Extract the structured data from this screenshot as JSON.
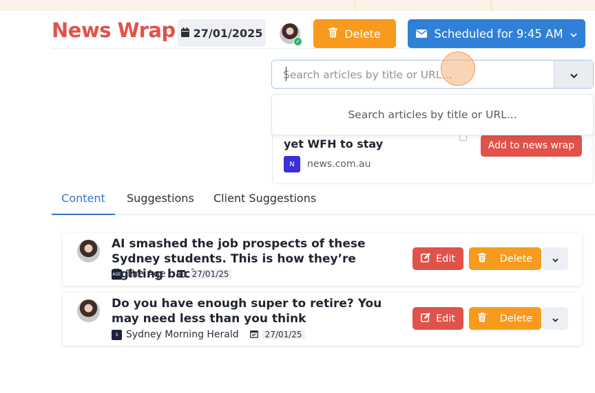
{
  "header": {
    "title": "News Wrap",
    "date": "27/01/2025",
    "delete_label": "Delete",
    "scheduled_label": "Scheduled for 9:45 AM"
  },
  "search": {
    "placeholder": "Search articles by title or URL...",
    "dropdown_text": "Search articles by title or URL..."
  },
  "suggestion_panel": {
    "title": "yet WFH to stay",
    "add_label": "Add to news wrap",
    "source_badge": "N",
    "source": "news.com.au"
  },
  "tabs": [
    "Content",
    "Suggestions",
    "Client Suggestions"
  ],
  "articles": [
    {
      "title": "AI smashed the job prospects of these Sydney students. This is how they’re fighting back",
      "source_badge": "AGE",
      "source": "The Age",
      "date": "27/01/25",
      "edit_label": "Edit",
      "delete_label": "Delete"
    },
    {
      "title": "Do you have enough super to retire? You may need less than you think",
      "source_badge": "S",
      "source": "Sydney Morning Herald",
      "date": "27/01/25",
      "edit_label": "Edit",
      "delete_label": "Delete"
    }
  ],
  "colors": {
    "brand_red": "#e0524a",
    "delete_orange": "#f79a1e",
    "primary_blue": "#2f80d6",
    "tab_active": "#3274c7"
  },
  "icons": [
    "calendar-icon",
    "trash-icon",
    "envelope-icon",
    "chevron-down-icon",
    "edit-icon",
    "verified-icon"
  ]
}
